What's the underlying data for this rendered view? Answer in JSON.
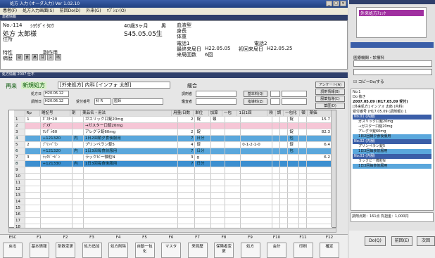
{
  "app": {
    "title": "処方 入力 (オーダ入力) Ver 1.02.10",
    "menu": [
      "患者(F)",
      "処方入力画面(S)",
      "前回Do(D)",
      "外来(G)",
      "ｵﾌﾟｼｮﾝ(O)"
    ]
  },
  "patient": {
    "section": "患者情報",
    "id": "No.-114",
    "kana": "ｼﾖｳﾀﾞｲ ﾀﾛｳ",
    "name_label": "処方",
    "name": "太郎様",
    "address_label": "住所",
    "age": "40歳3ヶ月",
    "sex": "男",
    "birth": "S45.05.05生",
    "labels": [
      "血液型",
      "身長",
      "体重",
      "電話1",
      "電話2"
    ],
    "last_visit_label": "最終来局日",
    "last_visit": "H22.05.05",
    "prev_visit_label": "初回来局日",
    "prev_visit": "H22.05.25",
    "visit_count_label": "来局回数",
    "visit_count": "6回",
    "traits_label": "特性",
    "traits2_label": "副作用",
    "history_label": "病歴",
    "history_items": [
      "疑",
      "食",
      "鼻",
      "甘",
      "ス",
      "咳"
    ]
  },
  "order": {
    "section": "処方情報 2007 仕不",
    "mode_label": "再来",
    "new_label": "新規処方",
    "text": "[外来処方] 内科 [インフォ 太郎]",
    "extra": "緩合",
    "date_label": "処方日",
    "date_value": "H20.06.12",
    "due_label": "調剤日",
    "due_value": "H20.06.12",
    "dept_label": "受付番号",
    "dept_value": "科 R",
    "doctor_value": "医師",
    "chk_labels": [
      "調剤者",
      "鑑査者"
    ],
    "btn_labels": [
      "基本料(Q)",
      "指導料(Z)"
    ],
    "side_btns": [
      "アンケート(A)",
      "調剤情報(B)",
      "服薬指導(C)",
      "薬歴(D)"
    ]
  },
  "grid": {
    "headers": [
      "Rp",
      "略記号",
      "剤",
      "薬品名・用法",
      "用量/日数",
      "単位",
      "加算",
      "一包",
      "1日1回",
      "粉",
      "調",
      "一包化",
      "頓",
      "薬価"
    ],
    "rows": [
      {
        "cls": "",
        "no": "1",
        "rp": "1",
        "code": "ｶﾞｽﾀｰ20",
        "kind": "",
        "name": "ガスリック口錠20mg",
        "qty": "2",
        "unit": "錠",
        "kasan": "頓",
        "dose": "",
        "mark": "錠",
        "price": "15.7"
      },
      {
        "cls": "pink",
        "no": "2",
        "rp": "",
        "code": "ﾌﾞｽﾀﾞ",
        "kind": "",
        "name": "→ガスター口錠20mg",
        "qty": "",
        "unit": "",
        "kasan": "",
        "dose": "",
        "mark": "",
        "price": ""
      },
      {
        "cls": "",
        "no": "3",
        "rp": "",
        "code": "ｱﾚｸﾞﾗ60",
        "kind": "",
        "name": "アレグラ錠60mg",
        "qty": "2",
        "unit": "錠",
        "kasan": "",
        "dose": "",
        "mark": "錠",
        "price": "82.3"
      },
      {
        "cls": "blue",
        "no": "4",
        "rp": "",
        "code": "+121320",
        "kind": "内",
        "name": "1日2回朝夕食後服用",
        "qty": "7",
        "unit": "日分",
        "kasan": "",
        "dose": "",
        "mark": "包",
        "price": ""
      },
      {
        "cls": "",
        "no": "5",
        "rp": "2",
        "code": "ﾌﾟﾘﾝﾍﾟﾗﾝ",
        "kind": "",
        "name": "プリンペラン錠5",
        "qty": "4",
        "unit": "錠",
        "kasan": "",
        "dose": "0-1-2-1-0",
        "mark": "錠",
        "price": "6.4"
      },
      {
        "cls": "blue",
        "no": "6",
        "rp": "",
        "code": "+121320",
        "kind": "内",
        "name": "1日3回毎食前服用",
        "qty": "7",
        "unit": "日分",
        "kasan": "",
        "dose": "",
        "mark": "包",
        "price": ""
      },
      {
        "cls": "",
        "no": "7",
        "rp": "3",
        "code": "ﾗｯｸﾋﾞｰﾋﾞﾝ",
        "kind": "",
        "name": "ラックビー微粒N",
        "qty": "3",
        "unit": "g",
        "kasan": "",
        "dose": "",
        "mark": "",
        "price": "6.2"
      },
      {
        "cls": "dblue",
        "no": "8",
        "rp": "",
        "code": "+121330",
        "kind": "内",
        "name": "1日3回毎食後服用",
        "qty": "7",
        "unit": "日分",
        "kasan": "",
        "dose": "",
        "mark": "",
        "price": ""
      },
      {
        "cls": "",
        "no": "9"
      },
      {
        "cls": "",
        "no": "10"
      },
      {
        "cls": "",
        "no": "11"
      },
      {
        "cls": "",
        "no": "12"
      },
      {
        "cls": "",
        "no": "13"
      },
      {
        "cls": "",
        "no": "14"
      },
      {
        "cls": "",
        "no": "15"
      },
      {
        "cls": "",
        "no": "16"
      },
      {
        "cls": "",
        "no": "17"
      },
      {
        "cls": "",
        "no": "18"
      }
    ]
  },
  "fkeys": [
    {
      "key": "ESC",
      "label": "戻る"
    },
    {
      "key": "F1",
      "label": "基本情報"
    },
    {
      "key": "F2",
      "label": "剤数変更"
    },
    {
      "key": "F3",
      "label": "処方追加"
    },
    {
      "key": "F4",
      "label": "処方削除"
    },
    {
      "key": "F5",
      "label": "自動一包化"
    },
    {
      "key": "F6",
      "label": "マスタ"
    },
    {
      "key": "F7",
      "label": "来局歴"
    },
    {
      "key": "F8",
      "label": "保険者変更"
    },
    {
      "key": "F9",
      "label": "処方"
    },
    {
      "key": "F10",
      "label": "会計"
    },
    {
      "key": "F11",
      "label": "印刷"
    },
    {
      "key": "F12",
      "label": "確定"
    }
  ],
  "right": {
    "top_item": "外来処方ﾁｪｯｸ",
    "section1": "医療機関・診療科",
    "chk": "コピーDo/する",
    "no": "No.1",
    "date": "Do 抜き",
    "date_full": "2007.05.09 (H17.05.09 受付)",
    "doctor": "[外来処方] インフォ 太郎 (内科)",
    "receipt": "受付番号 (H17.05.09 (調剤報)) 1",
    "drugs": [
      "No.01 (内服)",
      "ガスリック口錠20mg",
      "→ガスター口錠20mg",
      "アレグラ錠60mg",
      "1日2回朝夕食後服用",
      "No.02 (内服)",
      "プリンペラン錠5",
      "1日3回毎食前服用",
      "No.03 (内服)",
      "ラックビー微粒N",
      "1日3回毎食後服用"
    ],
    "total": "調剤点数：161点  負担金：1,000円",
    "btns": [
      "Do(Q)",
      "前回(E)",
      "次回"
    ]
  }
}
